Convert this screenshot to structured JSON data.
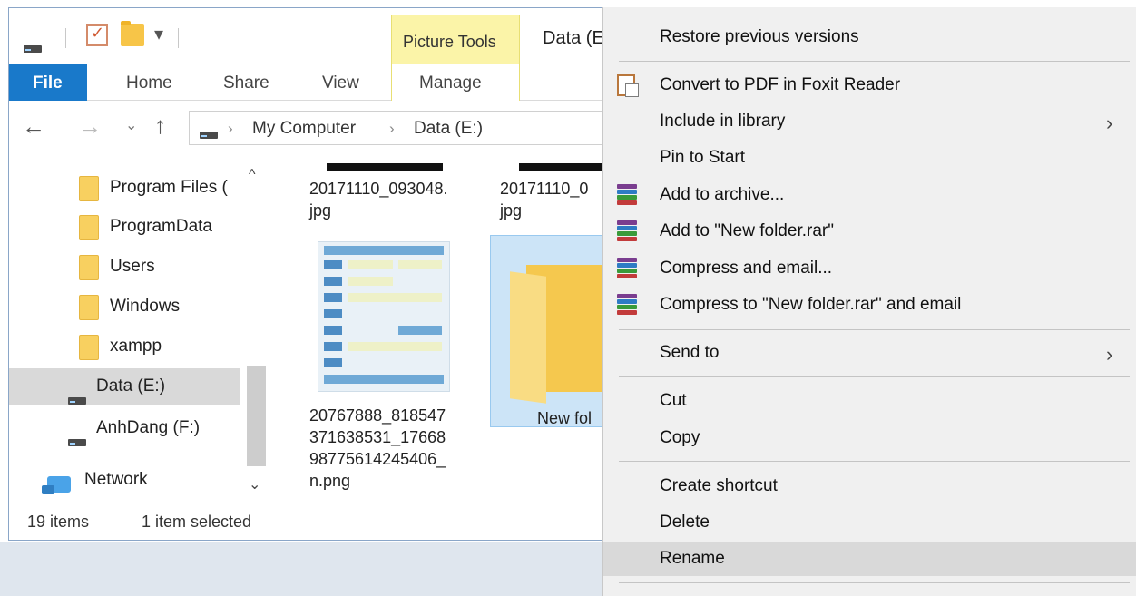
{
  "window": {
    "title": "Data (E",
    "picture_tools_label": "Picture Tools"
  },
  "ribbon": {
    "tabs": {
      "file": "File",
      "home": "Home",
      "share": "Share",
      "view": "View",
      "manage": "Manage"
    }
  },
  "address": {
    "breadcrumb": [
      "My Computer",
      "Data (E:)"
    ]
  },
  "nav_pane": {
    "items": [
      {
        "label": "Program Files (",
        "type": "folder"
      },
      {
        "label": "ProgramData",
        "type": "folder"
      },
      {
        "label": "Users",
        "type": "folder"
      },
      {
        "label": "Windows",
        "type": "folder"
      },
      {
        "label": "xampp",
        "type": "folder"
      },
      {
        "label": "Data (E:)",
        "type": "drive",
        "selected": true
      },
      {
        "label": "AnhDang (F:)",
        "type": "drive"
      },
      {
        "label": "Network",
        "type": "network"
      }
    ]
  },
  "files": {
    "file1": "20171110_093048.\njpg",
    "file2": "20171110_0\njpg",
    "file3": "20767888_818547\n371638531_17668\n98775614245406_\nn.png",
    "file4": "New fol"
  },
  "status": {
    "count": "19 items",
    "selection": "1 item selected"
  },
  "context_menu": {
    "items": [
      {
        "label": "Restore previous versions"
      },
      {
        "label": "Convert to PDF in Foxit Reader",
        "icon": "pdf-convert-icon"
      },
      {
        "label": "Include in library",
        "submenu": true
      },
      {
        "label": "Pin to Start"
      },
      {
        "label": "Add to archive...",
        "icon": "winrar-icon"
      },
      {
        "label": "Add to \"New folder.rar\"",
        "icon": "winrar-icon"
      },
      {
        "label": "Compress and email...",
        "icon": "winrar-icon"
      },
      {
        "label": "Compress to \"New folder.rar\" and email",
        "icon": "winrar-icon"
      },
      {
        "label": "Send to",
        "submenu": true
      },
      {
        "label": "Cut"
      },
      {
        "label": "Copy"
      },
      {
        "label": "Create shortcut"
      },
      {
        "label": "Delete"
      },
      {
        "label": "Rename",
        "highlighted": true
      }
    ]
  },
  "colors": {
    "file_tab": "#1979ca",
    "picture_tools": "#fbf4a8",
    "selection": "#cce4f7",
    "menu_bg": "#f0f0f0",
    "menu_highlight": "#d9d9d9"
  }
}
